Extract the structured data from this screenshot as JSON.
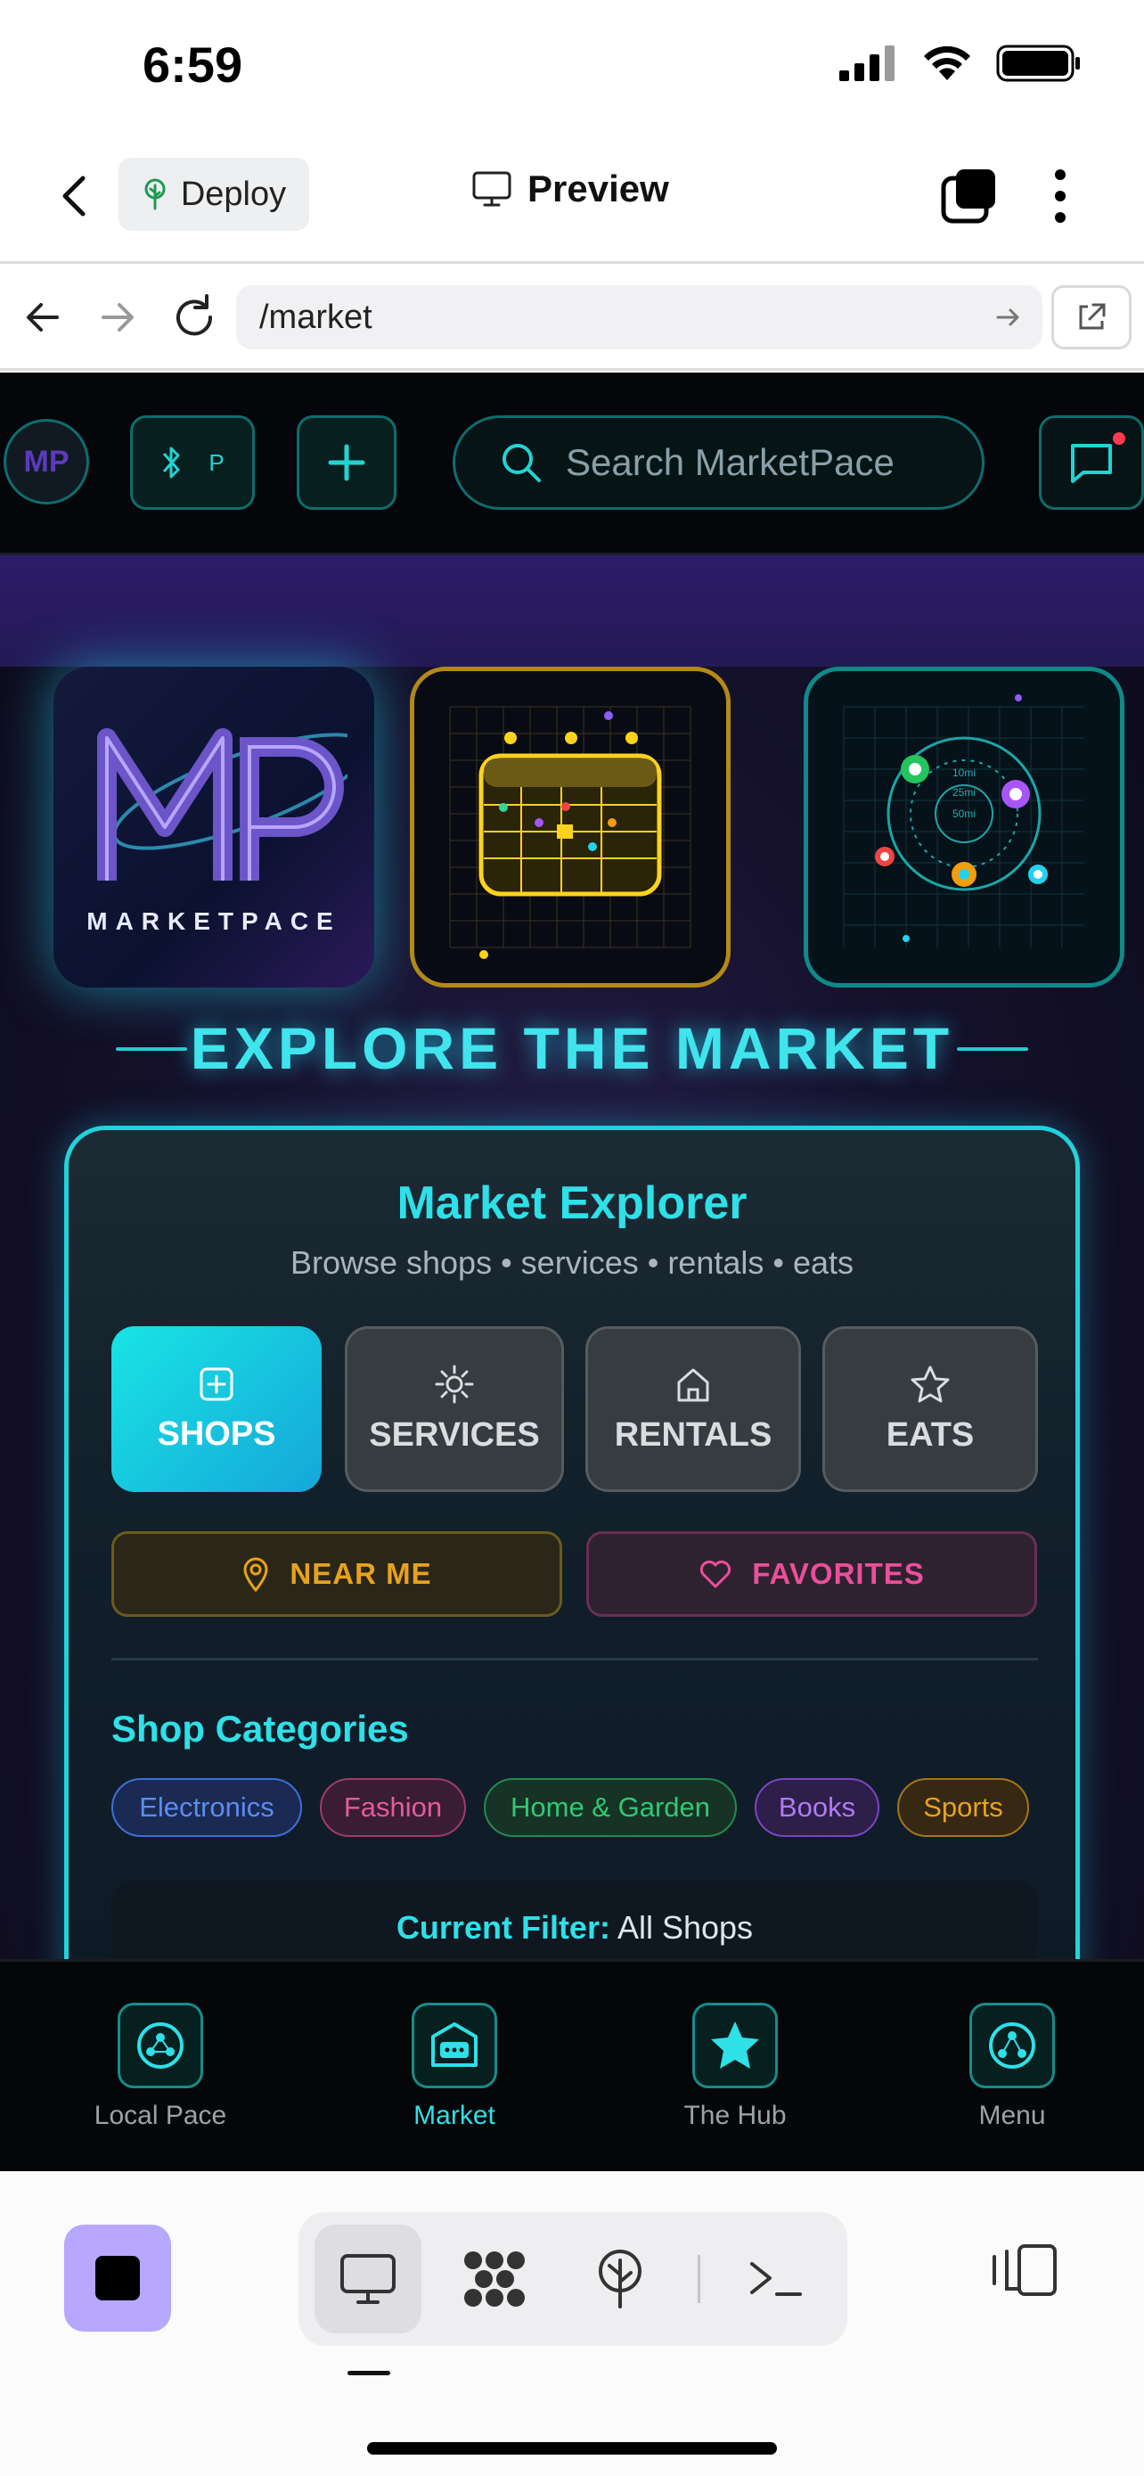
{
  "status_bar": {
    "time": "6:59"
  },
  "header": {
    "deploy_label": "Deploy",
    "preview_label": "Preview"
  },
  "browser": {
    "url": "/market"
  },
  "site": {
    "avatar_text": "MP",
    "bluetooth_chip_text": "P",
    "search_placeholder": "Search MarketPace",
    "logo_text": "MARKETPACE",
    "section_title": "EXPLORE THE MARKET",
    "explorer": {
      "title": "Market Explorer",
      "subtitle": "Browse shops • services • rentals • eats",
      "tabs": [
        {
          "label": "SHOPS",
          "icon": "plus-square-icon",
          "active": true
        },
        {
          "label": "SERVICES",
          "icon": "sun-icon",
          "active": false
        },
        {
          "label": "RENTALS",
          "icon": "home-icon",
          "active": false
        },
        {
          "label": "EATS",
          "icon": "star-icon",
          "active": false
        }
      ],
      "near_me_label": "NEAR ME",
      "favorites_label": "FAVORITES",
      "categories_title": "Shop Categories",
      "categories": [
        {
          "label": "Electronics",
          "color": "#3b6fd8"
        },
        {
          "label": "Fashion",
          "color": "#d04a86"
        },
        {
          "label": "Home & Garden",
          "color": "#2bb56a"
        },
        {
          "label": "Books",
          "color": "#9a5be0"
        },
        {
          "label": "Sports",
          "color": "#d99a1e"
        }
      ],
      "filter_label": "Current Filter:",
      "filter_value": "All Shops"
    },
    "bottom_nav": [
      {
        "label": "Local Pace",
        "icon": "network-icon",
        "active": false
      },
      {
        "label": "Market",
        "icon": "store-icon",
        "active": true
      },
      {
        "label": "The Hub",
        "icon": "star-icon",
        "active": false
      },
      {
        "label": "Menu",
        "icon": "menu-network-icon",
        "active": false
      }
    ]
  },
  "colors": {
    "accent": "#2ee0e8",
    "gold": "#e8a21e",
    "pink": "#ea4f9a",
    "stop_button": "#b7a7ff"
  }
}
